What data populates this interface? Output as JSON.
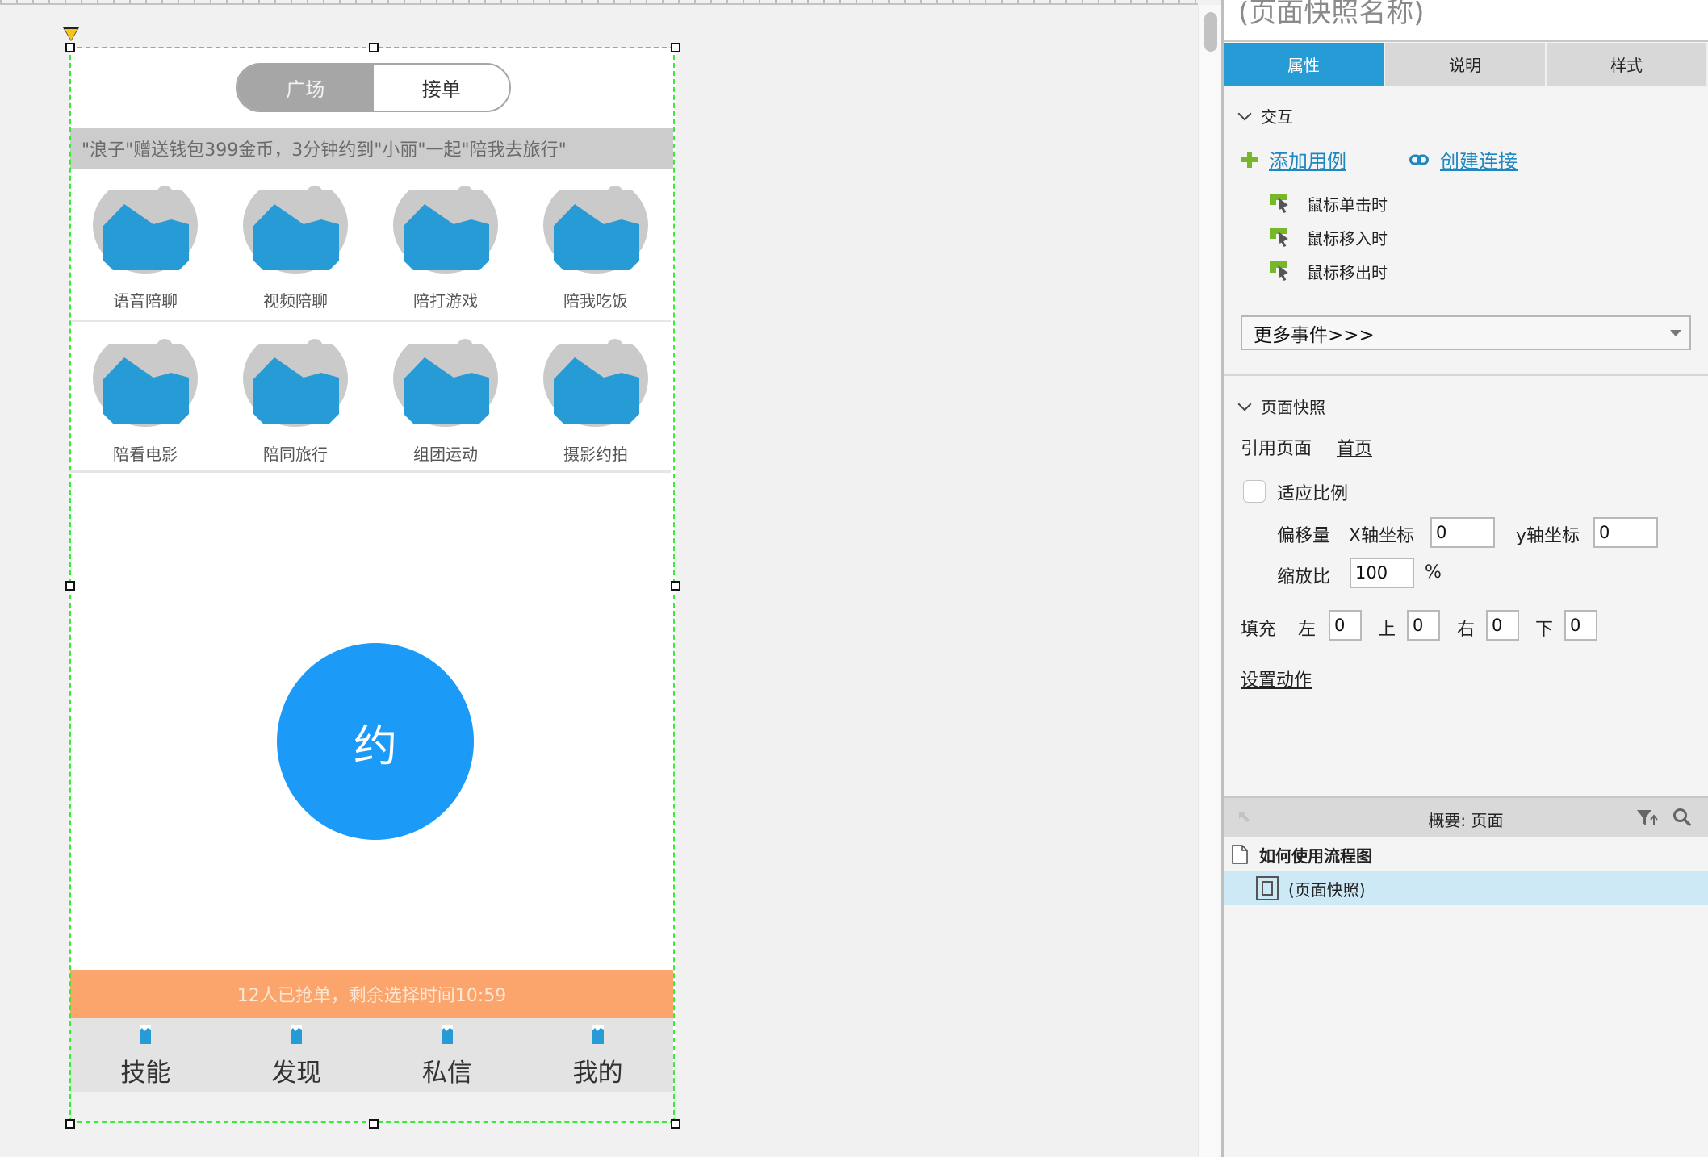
{
  "canvas": {
    "toggle": {
      "left_label": "广场",
      "right_label": "接单",
      "active": "广场"
    },
    "banner_text": "\"浪子\"赠送钱包399金币，3分钟约到\"小丽\"一起\"陪我去旅行\"",
    "grid": [
      [
        "语音陪聊",
        "视频陪聊",
        "陪打游戏",
        "陪我吃饭"
      ],
      [
        "陪看电影",
        "陪同旅行",
        "组团运动",
        "摄影约拍"
      ]
    ],
    "main_button": "约",
    "status_bar": "12人已抢单，剩余选择时间10:59",
    "bottom_tabs": [
      "技能",
      "发现",
      "私信",
      "我的"
    ],
    "colors": {
      "main_button": "#1b9af7",
      "status_bar": "#fba56c",
      "image_fill": "#269bd6"
    }
  },
  "panel": {
    "title": "(页面快照名称)",
    "tabs": [
      {
        "label": "属性",
        "active": true
      },
      {
        "label": "说明",
        "active": false
      },
      {
        "label": "样式",
        "active": false
      }
    ],
    "interaction": {
      "heading": "交互",
      "add_case": "添加用例",
      "create_link": "创建连接",
      "events": [
        "鼠标单击时",
        "鼠标移入时",
        "鼠标移出时"
      ],
      "more_events": "更多事件>>>"
    },
    "snapshot": {
      "heading": "页面快照",
      "ref_label": "引用页面",
      "ref_page": "首页",
      "fit_label": "适应比例",
      "fit_checked": false,
      "offset_label": "偏移量",
      "x_label": "X轴坐标",
      "x_value": "0",
      "y_label": "y轴坐标",
      "y_value": "0",
      "scale_label": "缩放比",
      "scale_value": "100",
      "scale_unit": "%",
      "fill_label": "填充",
      "left_label": "左",
      "left_value": "0",
      "top_label": "上",
      "top_value": "0",
      "right_label": "右",
      "right_value": "0",
      "bottom_label": "下",
      "bottom_value": "0",
      "set_action": "设置动作"
    },
    "outline": {
      "title": "概要: 页面",
      "items": [
        {
          "label": "如何使用流程图",
          "selected": false
        },
        {
          "label": "(页面快照)",
          "selected": true
        }
      ]
    },
    "colors": {
      "active_tab": "#269bd6",
      "link": "#1f87c0",
      "selected_row": "#cde9f6"
    }
  }
}
